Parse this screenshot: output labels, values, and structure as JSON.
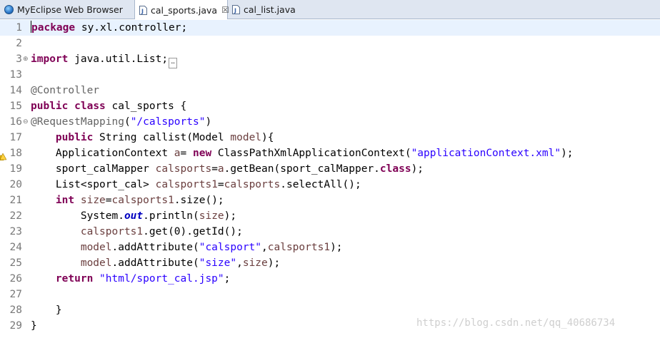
{
  "tabs": [
    {
      "label": "MyEclipse Web Browser",
      "icon": "globe-icon",
      "active": false
    },
    {
      "label": "cal_sports.java",
      "icon": "java-file-icon",
      "active": true,
      "close": "☒"
    },
    {
      "label": "cal_list.java",
      "icon": "java-file-icon",
      "active": false
    }
  ],
  "editor": {
    "lines": [
      {
        "n": "1",
        "current": true,
        "tokens": [
          [
            "kw",
            "package"
          ],
          [
            "t",
            " sy.xl.controller;"
          ]
        ]
      },
      {
        "n": "2",
        "tokens": []
      },
      {
        "n": "3",
        "fold": "expand",
        "tokens": [
          [
            "kw",
            "import"
          ],
          [
            "t",
            " java.util.List;"
          ]
        ],
        "collapsed": true
      },
      {
        "n": "13",
        "tokens": []
      },
      {
        "n": "14",
        "tokens": [
          [
            "ann",
            "@Controller"
          ]
        ]
      },
      {
        "n": "15",
        "tokens": [
          [
            "kw",
            "public"
          ],
          [
            "t",
            " "
          ],
          [
            "kw",
            "class"
          ],
          [
            "t",
            " cal_sports {"
          ]
        ]
      },
      {
        "n": "16",
        "fold": "collapse",
        "tokens": [
          [
            "ann",
            "@RequestMapping"
          ],
          [
            "t",
            "("
          ],
          [
            "str",
            "\"/calsports\""
          ],
          [
            "t",
            ")"
          ]
        ]
      },
      {
        "n": "17",
        "tokens": [
          [
            "t",
            "    "
          ],
          [
            "kw",
            "public"
          ],
          [
            "t",
            " String callist(Model "
          ],
          [
            "var",
            "model"
          ],
          [
            "t",
            "){"
          ]
        ]
      },
      {
        "n": "18",
        "warning": true,
        "tokens": [
          [
            "t",
            "    ApplicationContext "
          ],
          [
            "var",
            "a"
          ],
          [
            "t",
            "= "
          ],
          [
            "kw",
            "new"
          ],
          [
            "t",
            " ClassPathXmlApplicationContext("
          ],
          [
            "str",
            "\"applicationContext.xml\""
          ],
          [
            "t",
            ");"
          ]
        ]
      },
      {
        "n": "19",
        "tokens": [
          [
            "t",
            "    sport_calMapper "
          ],
          [
            "var",
            "calsports"
          ],
          [
            "t",
            "="
          ],
          [
            "var",
            "a"
          ],
          [
            "t",
            ".getBean(sport_calMapper."
          ],
          [
            "kw",
            "class"
          ],
          [
            "t",
            ");"
          ]
        ]
      },
      {
        "n": "20",
        "tokens": [
          [
            "t",
            "    List<sport_cal> "
          ],
          [
            "var",
            "calsports1"
          ],
          [
            "t",
            "="
          ],
          [
            "var",
            "calsports"
          ],
          [
            "t",
            ".selectAll();"
          ]
        ]
      },
      {
        "n": "21",
        "tokens": [
          [
            "t",
            "    "
          ],
          [
            "kw",
            "int"
          ],
          [
            "t",
            " "
          ],
          [
            "var",
            "size"
          ],
          [
            "t",
            "="
          ],
          [
            "var",
            "calsports1"
          ],
          [
            "t",
            ".size();"
          ]
        ]
      },
      {
        "n": "22",
        "tokens": [
          [
            "t",
            "        System."
          ],
          [
            "static",
            "out"
          ],
          [
            "t",
            ".println("
          ],
          [
            "var",
            "size"
          ],
          [
            "t",
            ");"
          ]
        ]
      },
      {
        "n": "23",
        "tokens": [
          [
            "t",
            "        "
          ],
          [
            "var",
            "calsports1"
          ],
          [
            "t",
            ".get(0).getId();"
          ]
        ]
      },
      {
        "n": "24",
        "tokens": [
          [
            "t",
            "        "
          ],
          [
            "var",
            "model"
          ],
          [
            "t",
            ".addAttribute("
          ],
          [
            "str",
            "\"calsport\""
          ],
          [
            "t",
            ","
          ],
          [
            "var",
            "calsports1"
          ],
          [
            "t",
            ");"
          ]
        ]
      },
      {
        "n": "25",
        "tokens": [
          [
            "t",
            "        "
          ],
          [
            "var",
            "model"
          ],
          [
            "t",
            ".addAttribute("
          ],
          [
            "str",
            "\"size\""
          ],
          [
            "t",
            ","
          ],
          [
            "var",
            "size"
          ],
          [
            "t",
            ");"
          ]
        ]
      },
      {
        "n": "26",
        "tokens": [
          [
            "t",
            "    "
          ],
          [
            "kw",
            "return"
          ],
          [
            "t",
            " "
          ],
          [
            "str",
            "\"html/sport_cal.jsp\""
          ],
          [
            "t",
            ";"
          ]
        ]
      },
      {
        "n": "27",
        "tokens": []
      },
      {
        "n": "28",
        "tokens": [
          [
            "t",
            "    }"
          ]
        ]
      },
      {
        "n": "29",
        "tokens": [
          [
            "t",
            "}"
          ]
        ]
      }
    ]
  },
  "watermark": "https://blog.csdn.net/qq_40686734",
  "colors": {
    "keyword": "#7f0055",
    "string": "#2a00ff",
    "annotation": "#646464",
    "local_variable": "#6a3e3e",
    "static_field": "#0000c0",
    "current_line": "#e8f2fe"
  }
}
